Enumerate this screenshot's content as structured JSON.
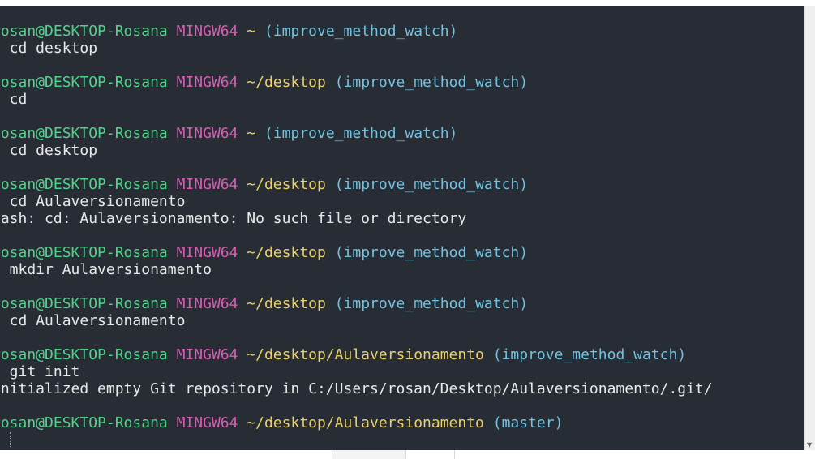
{
  "terminal": {
    "lines": [
      {
        "user": "rosan@DESKTOP-Rosana",
        "env": "MINGW64",
        "path": "~",
        "branch": "(improve_method_watch)"
      },
      {
        "cmd": "$ cd desktop"
      },
      {
        "blank": true
      },
      {
        "user": "rosan@DESKTOP-Rosana",
        "env": "MINGW64",
        "path": "~/desktop",
        "branch": "(improve_method_watch)"
      },
      {
        "cmd": "$ cd"
      },
      {
        "blank": true
      },
      {
        "user": "rosan@DESKTOP-Rosana",
        "env": "MINGW64",
        "path": "~",
        "branch": "(improve_method_watch)"
      },
      {
        "cmd": "$ cd desktop"
      },
      {
        "blank": true
      },
      {
        "user": "rosan@DESKTOP-Rosana",
        "env": "MINGW64",
        "path": "~/desktop",
        "branch": "(improve_method_watch)"
      },
      {
        "cmd": "$ cd Aulaversionamento"
      },
      {
        "out": "bash: cd: Aulaversionamento: No such file or directory"
      },
      {
        "blank": true
      },
      {
        "user": "rosan@DESKTOP-Rosana",
        "env": "MINGW64",
        "path": "~/desktop",
        "branch": "(improve_method_watch)"
      },
      {
        "cmd": "$ mkdir Aulaversionamento"
      },
      {
        "blank": true
      },
      {
        "user": "rosan@DESKTOP-Rosana",
        "env": "MINGW64",
        "path": "~/desktop",
        "branch": "(improve_method_watch)"
      },
      {
        "cmd": "$ cd Aulaversionamento"
      },
      {
        "blank": true
      },
      {
        "user": "rosan@DESKTOP-Rosana",
        "env": "MINGW64",
        "path": "~/desktop/Aulaversionamento",
        "branch": "(improve_method_watch)"
      },
      {
        "cmd": "$ git init"
      },
      {
        "out": "Initialized empty Git repository in C:/Users/rosan/Desktop/Aulaversionamento/.git/"
      },
      {
        "blank": true
      },
      {
        "user": "rosan@DESKTOP-Rosana",
        "env": "MINGW64",
        "path": "~/desktop/Aulaversionamento",
        "branch": "(master)"
      }
    ]
  },
  "colors": {
    "background": "#272c35",
    "user": "#4fd38a",
    "env": "#d65db1",
    "path": "#e8d06a",
    "branch": "#6ec3e0",
    "text": "#e8e8e8"
  },
  "icons": {
    "scroll_down": "scroll-down-arrow-icon"
  }
}
